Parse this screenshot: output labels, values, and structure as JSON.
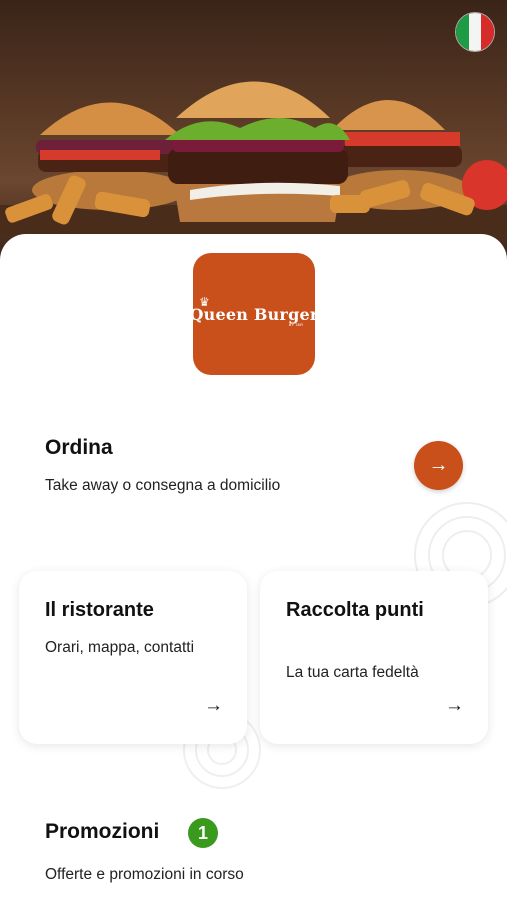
{
  "header": {
    "flag_icon": "italy-flag-icon",
    "flag_colors": [
      "#1f9b46",
      "#f4f4f4",
      "#d62b2b"
    ]
  },
  "brand": {
    "logo_text": "Queen Burger",
    "logo_subtext": "BY T&R",
    "logo_color": "#c94f1b"
  },
  "order": {
    "title": "Ordina",
    "subtitle": "Take away o consegna a domicilio",
    "button_icon": "arrow-right-icon"
  },
  "cards": [
    {
      "title": "Il ristorante",
      "subtitle": "Orari, mappa, contatti",
      "icon": "arrow-right-icon"
    },
    {
      "title": "Raccolta punti",
      "subtitle": "La tua carta fedeltà",
      "icon": "arrow-right-icon"
    }
  ],
  "promotions": {
    "title": "Promozioni",
    "badge_count": "1",
    "badge_color": "#3a9a1e",
    "subtitle": "Offerte e promozioni in corso"
  },
  "colors": {
    "accent": "#c94f1b",
    "badge": "#3a9a1e"
  }
}
